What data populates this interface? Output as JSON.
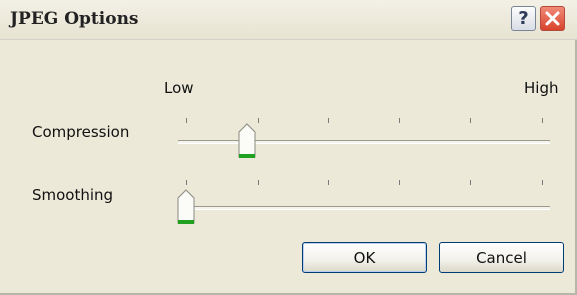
{
  "window": {
    "title": "JPEG Options",
    "help_glyph": "?",
    "help_icon": "question-mark-icon",
    "close_icon": "close-x-icon"
  },
  "scale": {
    "low_label": "Low",
    "high_label": "High"
  },
  "sliders": [
    {
      "label": "Compression",
      "value_fraction": 0.17
    },
    {
      "label": "Smoothing",
      "value_fraction": 0.0
    }
  ],
  "buttons": {
    "ok_label": "OK",
    "cancel_label": "Cancel"
  },
  "colors": {
    "dialog_bg": "#ece9d8",
    "close_button": "#d8432d",
    "thumb_accent": "#21a121"
  }
}
